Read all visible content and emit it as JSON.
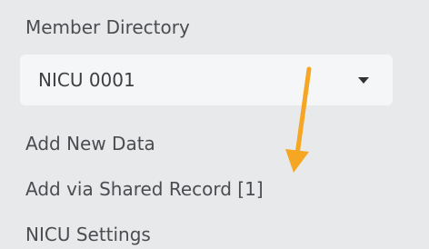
{
  "sidebar": {
    "member_directory": "Member Directory",
    "unit_select": {
      "value": "NICU 0001"
    },
    "add_new_data": "Add New Data",
    "add_shared_record": "Add via Shared Record [1]",
    "nicu_settings": "NICU Settings"
  },
  "annotation": {
    "arrow_color": "#f5a623"
  }
}
